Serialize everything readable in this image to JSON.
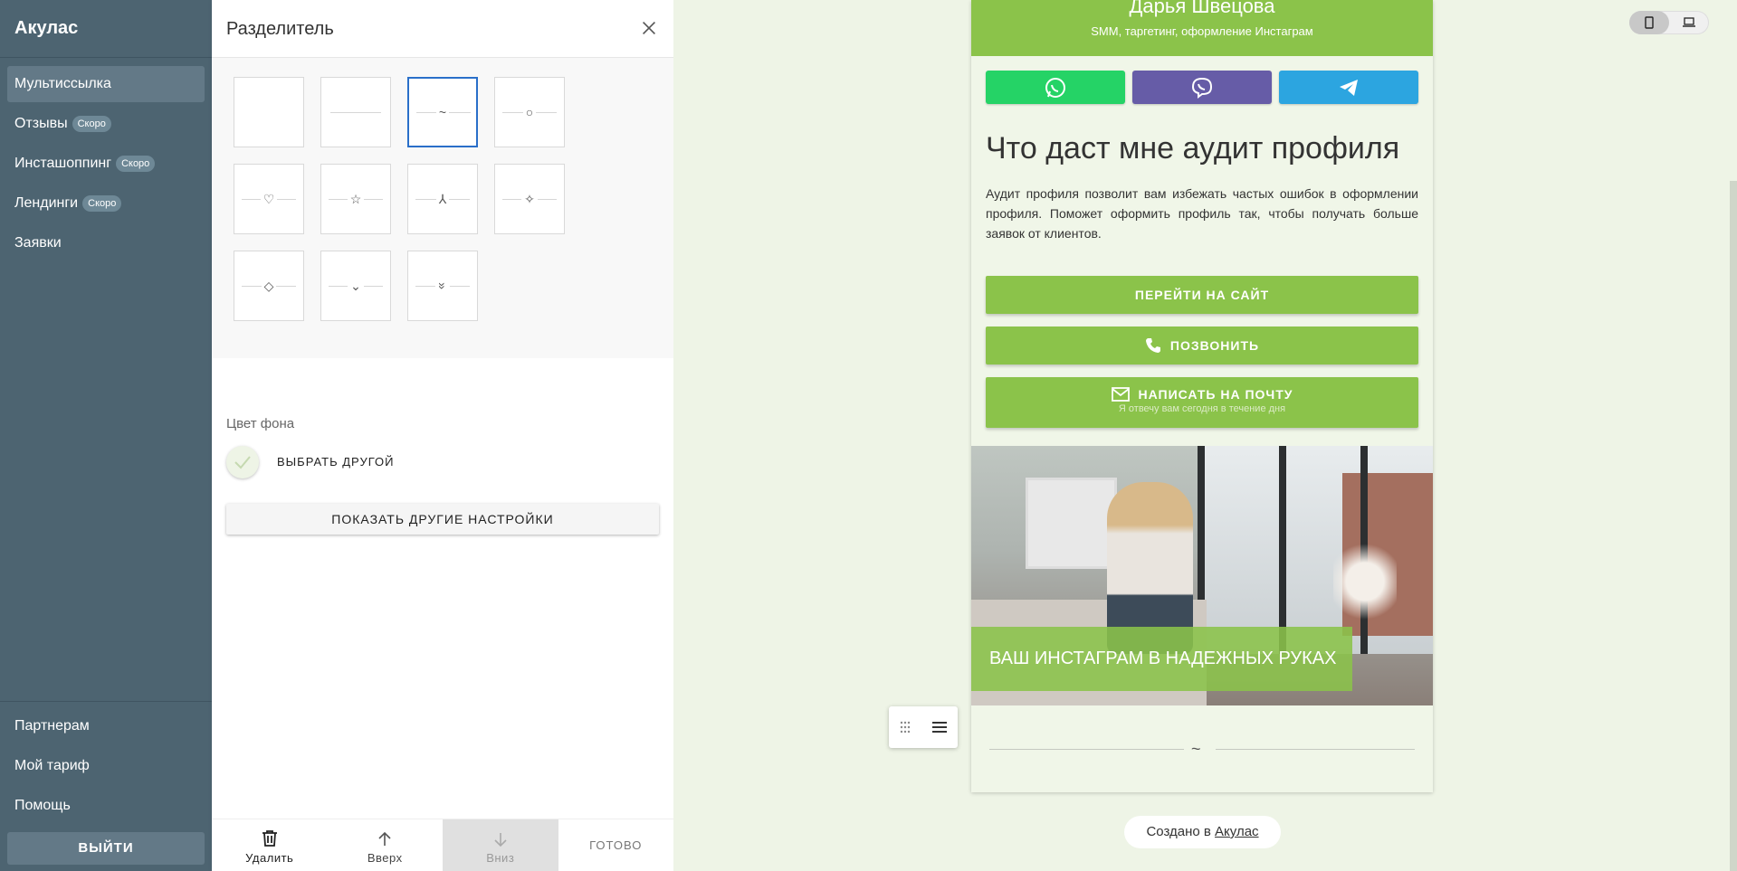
{
  "sidebar": {
    "brand": "Акулас",
    "items": [
      {
        "label": "Мультиссылка",
        "badge": ""
      },
      {
        "label": "Отзывы",
        "badge": "Скоро"
      },
      {
        "label": "Инсташоппинг",
        "badge": "Скоро"
      },
      {
        "label": "Лендинги",
        "badge": "Скоро"
      },
      {
        "label": "Заявки",
        "badge": ""
      }
    ],
    "bottom_items": [
      {
        "label": "Партнерам"
      },
      {
        "label": "Мой тариф"
      },
      {
        "label": "Помощь"
      }
    ],
    "logout_label": "ВЫЙТИ"
  },
  "panel": {
    "title": "Разделитель",
    "dividers": [
      {
        "symbol": "",
        "lines": false
      },
      {
        "symbol": "",
        "lines": true
      },
      {
        "symbol": "~",
        "lines": true,
        "selected": true
      },
      {
        "symbol": "○",
        "lines": true
      },
      {
        "symbol": "♡",
        "lines": true
      },
      {
        "symbol": "☆",
        "lines": true
      },
      {
        "symbol": "⅄",
        "lines": true
      },
      {
        "symbol": "✧",
        "lines": true
      },
      {
        "symbol": "◇",
        "lines": true
      },
      {
        "symbol": "⌄",
        "lines": true
      },
      {
        "symbol": "»",
        "lines": true
      }
    ],
    "bg_label": "Цвет фона",
    "choose_other_label": "ВЫБРАТЬ ДРУГОЙ",
    "show_more_label": "ПОКАЗАТЬ ДРУГИЕ НАСТРОЙКИ",
    "footer": {
      "delete_label": "Удалить",
      "up_label": "Вверх",
      "down_label": "Вниз",
      "done_label": "ГОТОВО"
    }
  },
  "preview": {
    "name": "Дарья Швецова",
    "subtitle": "SMM, таргетинг, оформление Инстаграм",
    "messengers": [
      {
        "name": "whatsapp-icon",
        "color": "#25d366"
      },
      {
        "name": "viber-icon",
        "color": "#665ca7"
      },
      {
        "name": "telegram-icon",
        "color": "#2ca5e0"
      }
    ],
    "heading": "Что даст мне аудит профиля",
    "paragraph": "Аудит профиля позволит вам избежать частых ошибок в оформлении профиля. Поможет оформить профиль так, чтобы получать больше заявок от клиентов.",
    "buttons": {
      "site": "ПЕРЕЙТИ НА САЙТ",
      "call": "ПОЗВОНИТЬ",
      "mail": "НАПИСАТЬ НА ПОЧТУ",
      "mail_sub": "Я отвечу вам сегодня в течение дня"
    },
    "photo_caption": "ВАШ ИНСТАГРАМ В НАДЕЖНЫХ РУКАХ",
    "divider_symbol": "~",
    "created_prefix": "Создано в",
    "created_link": "Акулас"
  },
  "colors": {
    "sidebar": "#4d6471",
    "accent": "#8bc34a",
    "selected": "#2a6fc9",
    "preview_bg": "#eef4e6"
  }
}
